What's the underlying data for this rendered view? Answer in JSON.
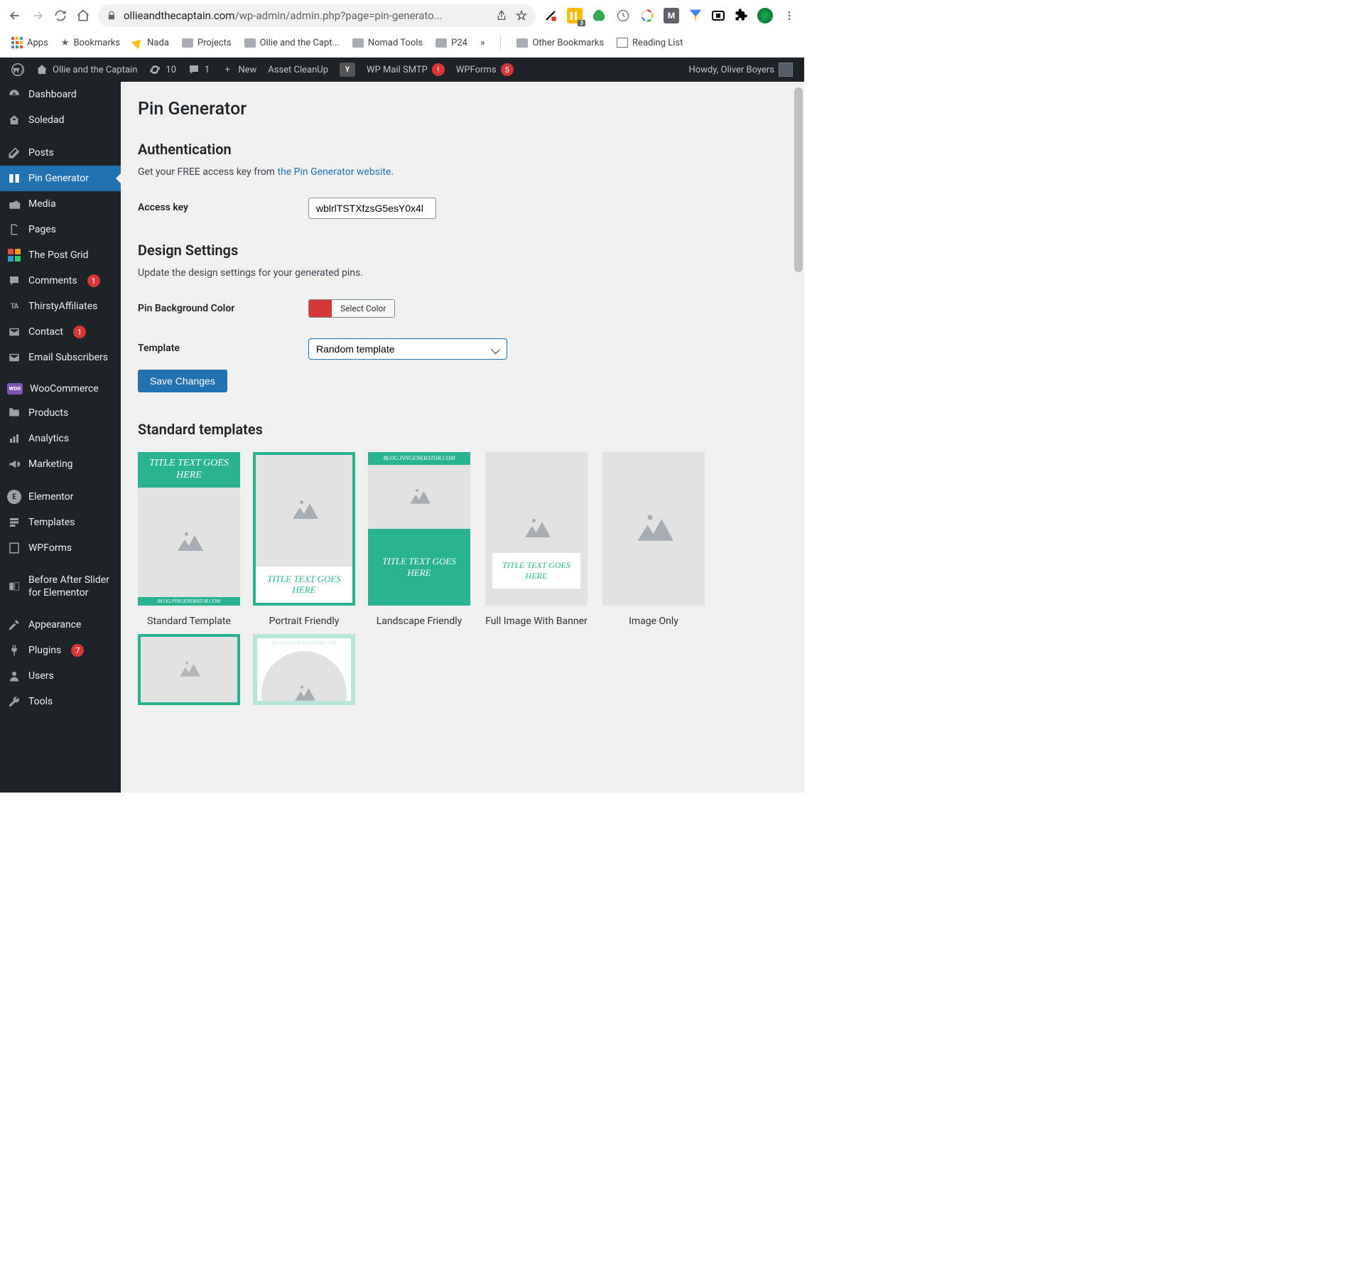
{
  "browser": {
    "url_host": "ollieandthecaptain.com",
    "url_path": "/wp-admin/admin.php?page=pin-generato...",
    "ext_badge": "3"
  },
  "bookmarks": {
    "apps": "Apps",
    "items": [
      "Bookmarks",
      "Nada",
      "Projects",
      "Ollie and the Capt...",
      "Nomad Tools",
      "P24"
    ],
    "more": "»",
    "other": "Other Bookmarks",
    "reading": "Reading List"
  },
  "adminbar": {
    "site": "Ollie and the Captain",
    "updates": "10",
    "comments": "1",
    "new": "New",
    "asset": "Asset CleanUp",
    "smtp": "WP Mail SMTP",
    "smtp_badge": "!",
    "wpforms": "WPForms",
    "wpforms_badge": "5",
    "howdy": "Howdy, Oliver Boyers"
  },
  "sidebar": {
    "dashboard": "Dashboard",
    "soledad": "Soledad",
    "posts": "Posts",
    "pin_generator": "Pin Generator",
    "media": "Media",
    "pages": "Pages",
    "post_grid": "The Post Grid",
    "comments": "Comments",
    "comments_badge": "1",
    "thirsty": "ThirstyAffiliates",
    "contact": "Contact",
    "contact_badge": "1",
    "email_sub": "Email Subscribers",
    "woo": "WooCommerce",
    "products": "Products",
    "analytics": "Analytics",
    "marketing": "Marketing",
    "elementor": "Elementor",
    "templates": "Templates",
    "wpforms": "WPForms",
    "before_after": "Before After Slider for Elementor",
    "appearance": "Appearance",
    "plugins": "Plugins",
    "plugins_badge": "7",
    "users": "Users",
    "tools": "Tools"
  },
  "page": {
    "title": "Pin Generator",
    "auth_heading": "Authentication",
    "auth_text_pre": "Get your FREE access key from ",
    "auth_link": "the Pin Generator website",
    "auth_text_post": ".",
    "access_key_label": "Access key",
    "access_key_value": "wblrlTSTXfzsG5esY0x4l",
    "design_heading": "Design Settings",
    "design_text": "Update the design settings for your generated pins.",
    "bg_label": "Pin Background Color",
    "select_color": "Select Color",
    "bg_color": "#d63638",
    "template_label": "Template",
    "template_value": "Random template",
    "save": "Save Changes",
    "std_heading": "Standard templates",
    "templates": [
      {
        "name": "Standard Template",
        "title": "TITLE TEXT GOES HERE",
        "footer": "BLOG.PINGENERATOR.COM"
      },
      {
        "name": "Portrait Friendly",
        "title": "TITLE TEXT GOES HERE"
      },
      {
        "name": "Landscape Friendly",
        "header": "BLOG.PINGENERATOR.COM",
        "title": "TITLE TEXT GOES HERE"
      },
      {
        "name": "Full Image With Banner",
        "title": "TITLE TEXT GOES HERE"
      },
      {
        "name": "Image Only"
      }
    ],
    "row2_header": "BLOG.PINGENERATOR.COM"
  }
}
